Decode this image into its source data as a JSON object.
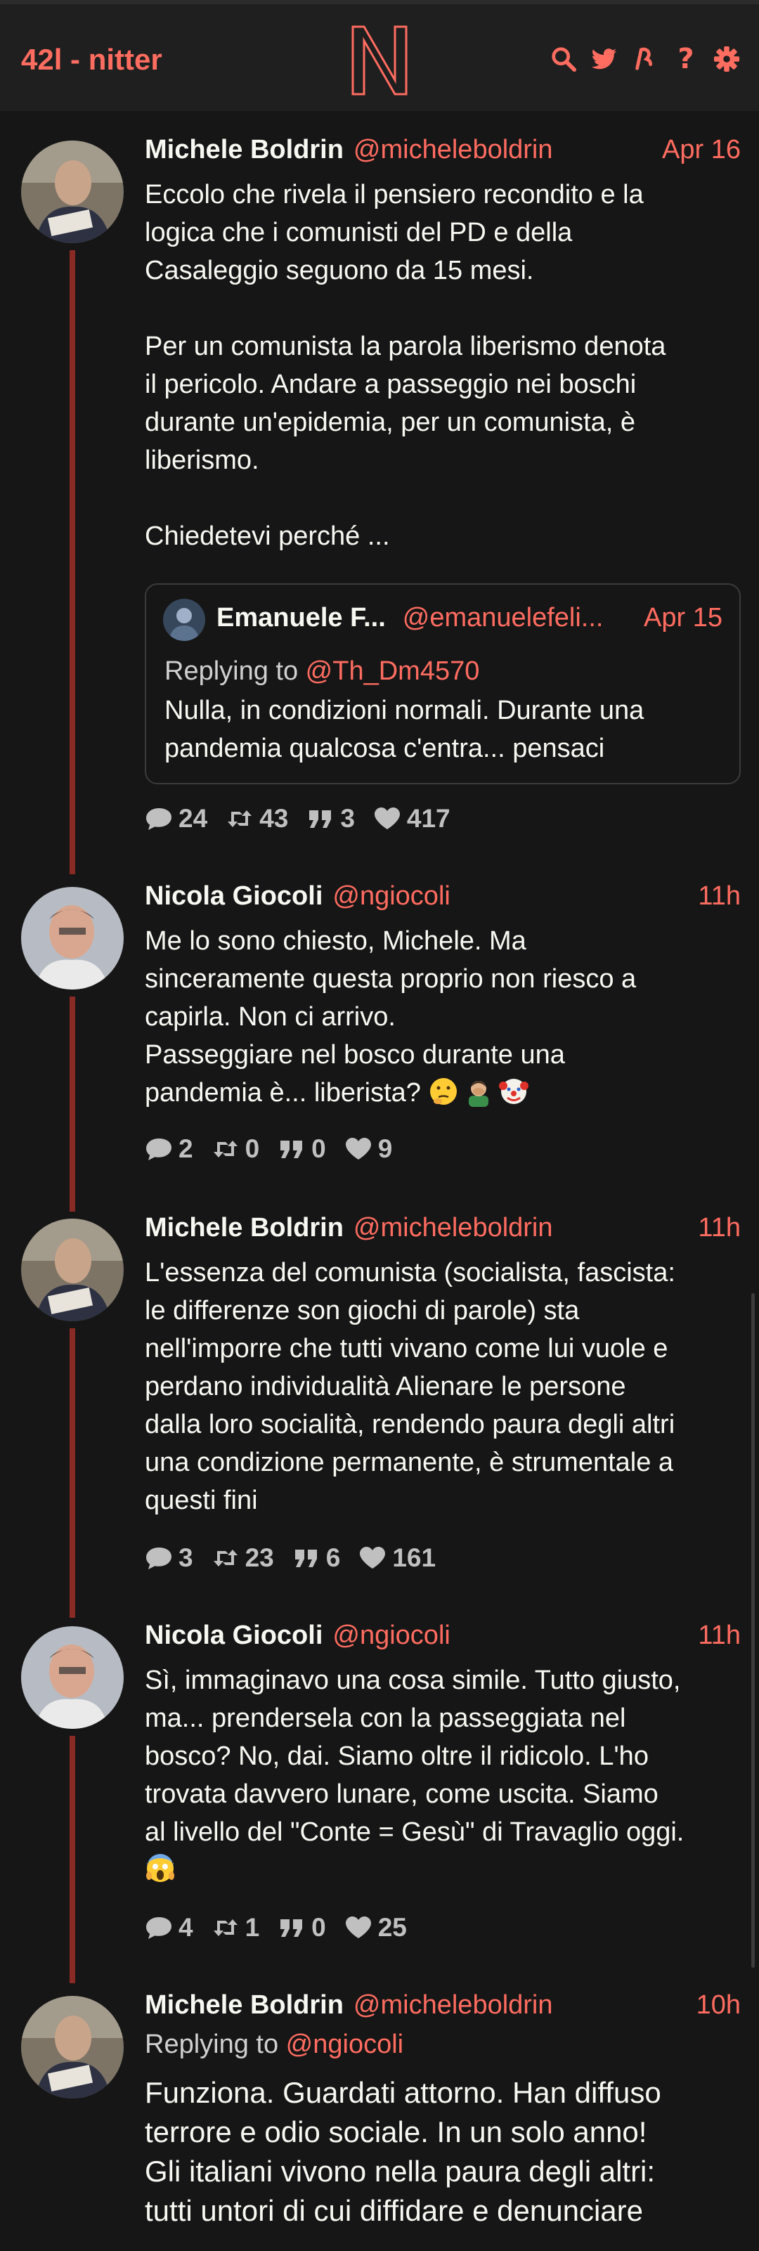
{
  "navbar": {
    "title": "42l - nitter",
    "logo_letter": "N",
    "icons": [
      "search-icon",
      "twitter-bird-icon",
      "rss-icon",
      "help-icon",
      "settings-gear-icon"
    ],
    "help_label": "?"
  },
  "colors": {
    "accent": "#ff6c60",
    "background": "#161616",
    "panel": "#1f1f1f",
    "thread_line": "#8a2a25"
  },
  "tweets": [
    {
      "fullname": "Michele Boldrin",
      "username": "@micheleboldrin",
      "date": "Apr 16",
      "text": "Eccolo che rivela il pensiero recondito e la\nlogica che i comunisti del PD e della\nCasaleggio seguono da 15 mesi.\n\nPer un comunista la parola liberismo denota\nil pericolo. Andare a passeggio nei boschi\ndurante un'epidemia, per un comunista, è\nliberismo.\n\nChiedetevi perché ...",
      "quote": {
        "fullname": "Emanuele F...",
        "username": "@emanuelefeli...",
        "date": "Apr 15",
        "replying_prefix": "Replying to ",
        "replying_to": "@Th_Dm4570",
        "text": "Nulla, in condizioni normali. Durante una\npandemia qualcosa c'entra... pensaci"
      },
      "stats": {
        "replies": "24",
        "retweets": "43",
        "quotes": "3",
        "likes": "417"
      }
    },
    {
      "fullname": "Nicola Giocoli",
      "username": "@ngiocoli",
      "date": "11h",
      "text": "Me lo sono chiesto, Michele. Ma\nsinceramente questa proprio non riesco a\ncapirla. Non ci arrivo.\nPasseggiare nel bosco durante una\npandemia è... liberista?",
      "emojis": [
        "thinking-face",
        "man-facepalming",
        "clown-face"
      ],
      "stats": {
        "replies": "2",
        "retweets": "0",
        "quotes": "0",
        "likes": "9"
      }
    },
    {
      "fullname": "Michele Boldrin",
      "username": "@micheleboldrin",
      "date": "11h",
      "text": "L'essenza del comunista (socialista, fascista:\nle differenze son giochi di parole) sta\nnell'imporre che tutti vivano come lui vuole e\nperdano individualità Alienare le persone\ndalla loro socialità, rendendo paura degli altri\nuna condizione permanente, è strumentale a\nquesti fini",
      "stats": {
        "replies": "3",
        "retweets": "23",
        "quotes": "6",
        "likes": "161"
      }
    },
    {
      "fullname": "Nicola Giocoli",
      "username": "@ngiocoli",
      "date": "11h",
      "text": "Sì, immaginavo una cosa simile. Tutto giusto,\nma... prendersela con la passeggiata nel\nbosco? No, dai. Siamo oltre il ridicolo. L'ho\ntrovata davvero lunare, come uscita. Siamo\nal livello del \"Conte = Gesù\" di Travaglio oggi.",
      "emojis": [
        "face-screaming-in-fear"
      ],
      "stats": {
        "replies": "4",
        "retweets": "1",
        "quotes": "0",
        "likes": "25"
      }
    },
    {
      "fullname": "Michele Boldrin",
      "username": "@micheleboldrin",
      "date": "10h",
      "replying_prefix": "Replying to ",
      "replying_to": "@ngiocoli",
      "text": "Funziona. Guardati attorno. Han diffuso\nterrore e odio sociale. In un solo anno!\nGli italiani vivono nella paura degli altri:\ntutti untori di cui diffidare e denunciare"
    }
  ]
}
